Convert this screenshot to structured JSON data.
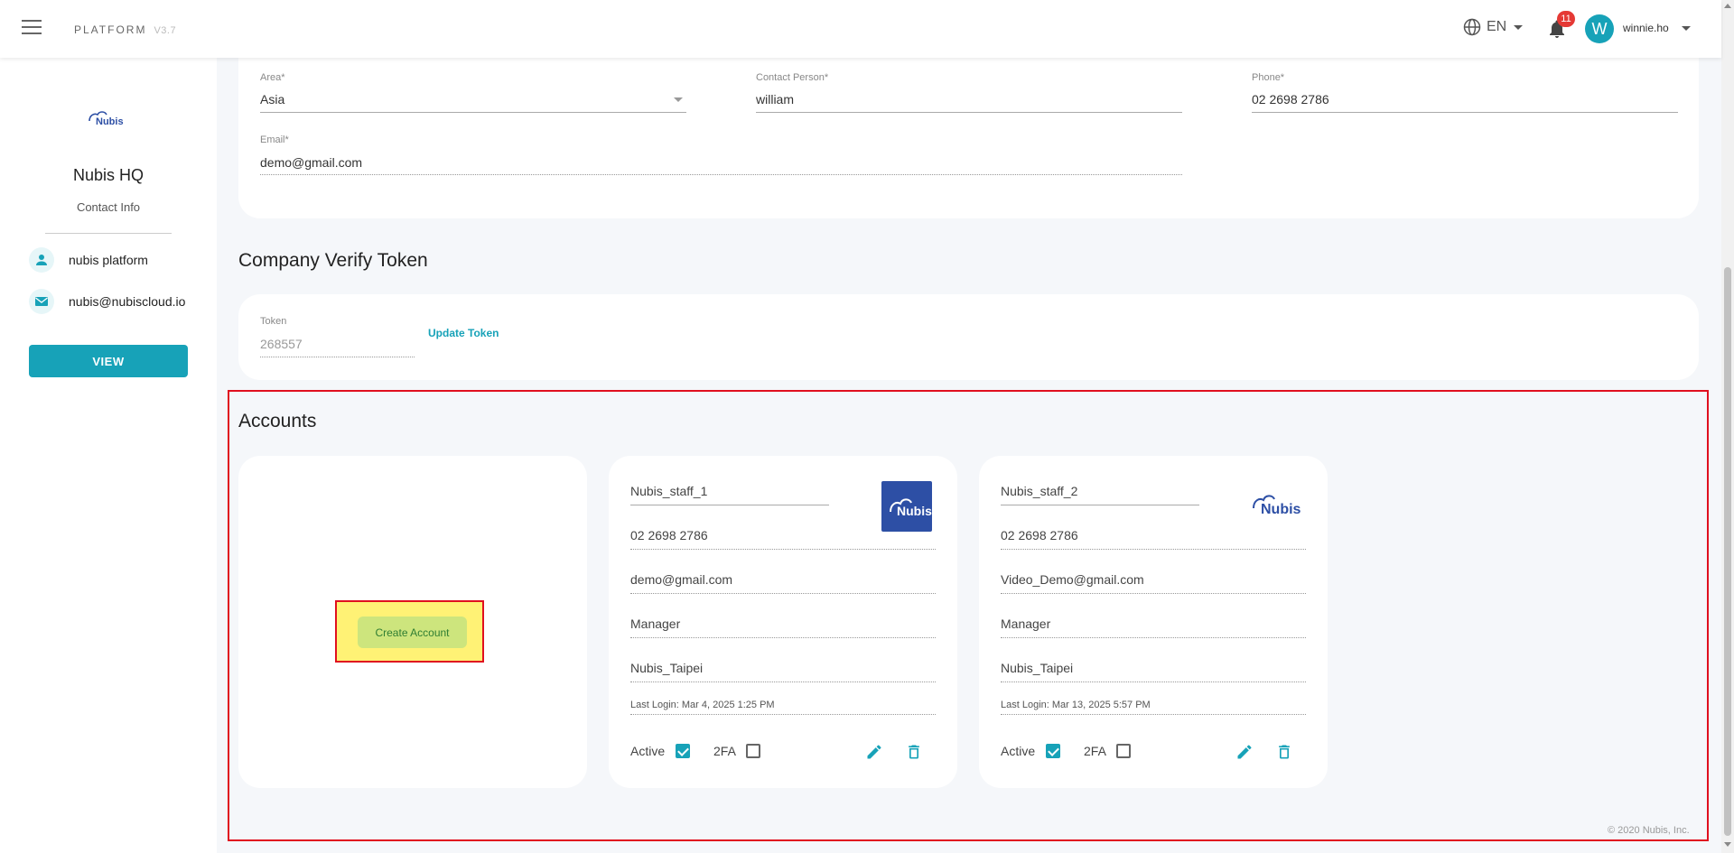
{
  "header": {
    "brand": "PLATFORM",
    "version": "V3.7",
    "language": "EN",
    "notification_count": "11",
    "avatar_initial": "W",
    "username": "winnie.ho"
  },
  "sidebar": {
    "logo_text": "Nubis",
    "org_name": "Nubis HQ",
    "subtitle": "Contact Info",
    "contact_name": "nubis platform",
    "contact_email": "nubis@nubiscloud.io",
    "view_label": "VIEW"
  },
  "contact_form": {
    "area_label": "Area*",
    "area_value": "Asia",
    "contact_label": "Contact Person*",
    "contact_value": "william",
    "phone_label": "Phone*",
    "phone_value": "02 2698 2786",
    "email_label": "Email*",
    "email_value": "demo@gmail.com"
  },
  "token": {
    "section_title": "Company Verify Token",
    "label": "Token",
    "value": "268557",
    "update_label": "Update Token"
  },
  "accounts": {
    "section_title": "Accounts",
    "create_label": "Create Account",
    "items": [
      {
        "name": "Nubis_staff_1",
        "phone": "02 2698 2786",
        "email": "demo@gmail.com",
        "role": "Manager",
        "location": "Nubis_Taipei",
        "last_login": "Last Login: Mar 4, 2025 1:25 PM",
        "active_label": "Active",
        "active": true,
        "twofa_label": "2FA",
        "twofa": false
      },
      {
        "name": "Nubis_staff_2",
        "phone": "02 2698 2786",
        "email": "Video_Demo@gmail.com",
        "role": "Manager",
        "location": "Nubis_Taipei",
        "last_login": "Last Login: Mar 13, 2025 5:57 PM",
        "active_label": "Active",
        "active": true,
        "twofa_label": "2FA",
        "twofa": false
      }
    ]
  },
  "footer": "© 2020 Nubis, Inc.",
  "colors": {
    "accent": "#17a2b8",
    "badge": "#e53935",
    "highlight_border": "#e0101f",
    "highlight_fill": "#fff275",
    "create_button": "#cde57d"
  }
}
